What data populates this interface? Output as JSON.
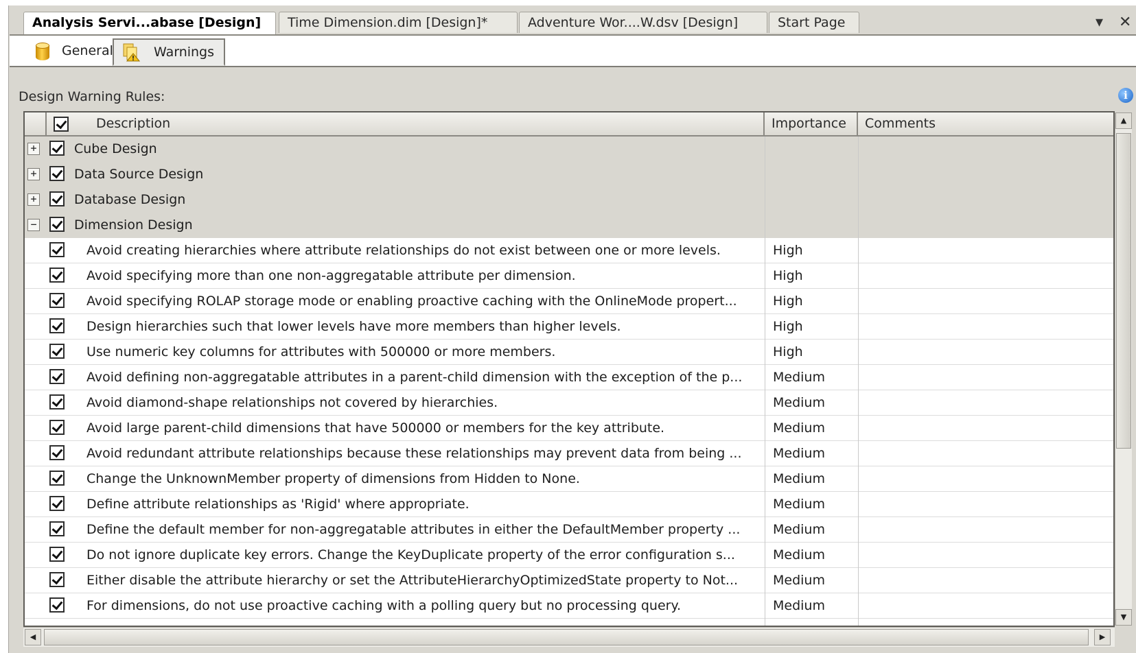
{
  "doc_tabs": [
    {
      "label": "Analysis Servi...abase [Design]",
      "active": true
    },
    {
      "label": "Time Dimension.dim [Design]*",
      "active": false
    },
    {
      "label": "Adventure Wor....W.dsv [Design]",
      "active": false
    },
    {
      "label": "Start Page",
      "active": false
    }
  ],
  "tab_controls": {
    "dropdown": "▾",
    "close": "✕"
  },
  "inner_tabs": [
    {
      "label": "General",
      "icon": "database-icon",
      "active": false
    },
    {
      "label": "Warnings",
      "icon": "warnings-icon",
      "active": true
    }
  ],
  "section_label": "Design Warning Rules:",
  "info_icon": "i",
  "columns": {
    "description": "Description",
    "importance": "Importance",
    "comments": "Comments"
  },
  "groups": [
    {
      "label": "Cube Design",
      "expanded": false,
      "checked": true
    },
    {
      "label": "Data Source Design",
      "expanded": false,
      "checked": true
    },
    {
      "label": "Database Design",
      "expanded": false,
      "checked": true
    },
    {
      "label": "Dimension Design",
      "expanded": true,
      "checked": true
    }
  ],
  "rules": [
    {
      "description": "Avoid creating hierarchies where attribute relationships do not exist between one or more levels.",
      "importance": "High",
      "checked": true
    },
    {
      "description": "Avoid specifying more than one non-aggregatable attribute per dimension.",
      "importance": "High",
      "checked": true
    },
    {
      "description": "Avoid specifying ROLAP storage mode or enabling proactive caching with the OnlineMode propert...",
      "importance": "High",
      "checked": true
    },
    {
      "description": "Design hierarchies such that lower levels have more members than higher levels.",
      "importance": "High",
      "checked": true
    },
    {
      "description": "Use numeric key columns for attributes with 500000 or more members.",
      "importance": "High",
      "checked": true
    },
    {
      "description": "Avoid defining non-aggregatable attributes in a parent-child dimension with the exception of the p...",
      "importance": "Medium",
      "checked": true
    },
    {
      "description": "Avoid diamond-shape relationships not covered by hierarchies.",
      "importance": "Medium",
      "checked": true
    },
    {
      "description": "Avoid large parent-child dimensions that have 500000 or members for the key attribute.",
      "importance": "Medium",
      "checked": true
    },
    {
      "description": "Avoid redundant attribute relationships because these relationships may prevent data from being ...",
      "importance": "Medium",
      "checked": true
    },
    {
      "description": "Change the UnknownMember property of dimensions from Hidden to None.",
      "importance": "Medium",
      "checked": true
    },
    {
      "description": "Define attribute relationships as 'Rigid' where appropriate.",
      "importance": "Medium",
      "checked": true
    },
    {
      "description": "Define the default member for non-aggregatable attributes in either the DefaultMember property ...",
      "importance": "Medium",
      "checked": true
    },
    {
      "description": "Do not ignore duplicate key errors. Change the KeyDuplicate property of the error configuration s...",
      "importance": "Medium",
      "checked": true
    },
    {
      "description": "Either disable the attribute hierarchy or set the AttributeHierarchyOptimizedState property to Not...",
      "importance": "Medium",
      "checked": true
    },
    {
      "description": "For dimensions, do not use proactive caching with a polling query but no processing query.",
      "importance": "Medium",
      "checked": true
    }
  ],
  "scroll": {
    "up": "▲",
    "down": "▼",
    "left": "◀",
    "right": "▶"
  }
}
